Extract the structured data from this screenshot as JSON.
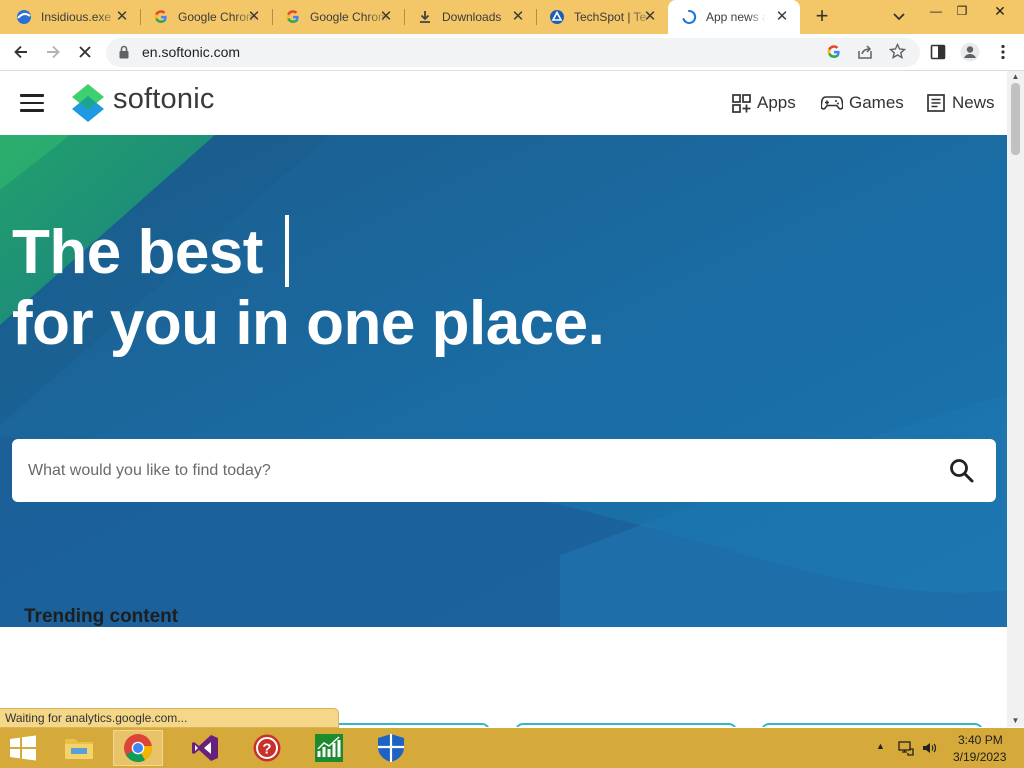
{
  "browser": {
    "tabs": [
      {
        "title": "Insidious.exe",
        "icon": "chrome-tab-icon"
      },
      {
        "title": "Google Chrome",
        "icon": "google-icon"
      },
      {
        "title": "Google Chrome",
        "icon": "google-icon"
      },
      {
        "title": "Downloads",
        "icon": "download-icon"
      },
      {
        "title": "TechSpot | Te",
        "icon": "techspot-icon"
      },
      {
        "title": "App news and",
        "icon": "loading-spinner-icon"
      }
    ],
    "url": "en.softonic.com",
    "status_text": "Waiting for analytics.google.com..."
  },
  "site": {
    "logo_text": "softonic",
    "nav": {
      "apps": "Apps",
      "games": "Games",
      "news": "News"
    },
    "hero": {
      "line1": "The best",
      "line2": "for you in one place.",
      "search_placeholder": "What would you like to find today?"
    },
    "trending_title": "Trending content"
  },
  "taskbar": {
    "apps": [
      "file-explorer-icon",
      "chrome-icon",
      "visual-studio-icon",
      "help-icon",
      "stock-chart-icon",
      "defender-icon"
    ],
    "time": "3:40 PM",
    "date": "3/19/2023"
  },
  "colors": {
    "chrome_frame": "#f3c768",
    "taskbar": "#d6a93b",
    "hero_blue": "#1a6aa0",
    "hero_green": "#1e9a6e",
    "brand_green": "#3ecf6e",
    "brand_blue": "#1f9ae0"
  }
}
